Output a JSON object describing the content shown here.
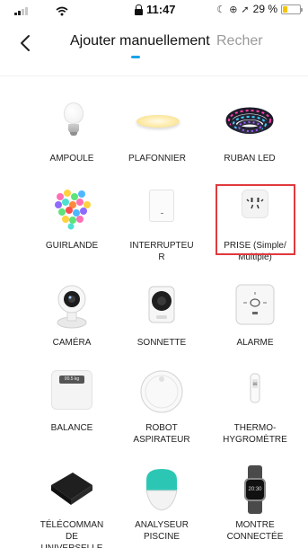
{
  "status_bar": {
    "time": "11:47",
    "battery_text": "29 %",
    "battery_level": 0.29,
    "icons": [
      "signal-icon",
      "wifi-icon",
      "lock-icon",
      "moon-icon",
      "location-icon",
      "battery-icon"
    ]
  },
  "header": {
    "back_icon": "chevron-left-icon",
    "tabs": [
      {
        "label": "Ajouter manuellement",
        "active": true
      },
      {
        "label": "Recher",
        "active": false
      }
    ],
    "accent_color": "#1aa3e8"
  },
  "selection_color": "#e0393e",
  "devices": [
    {
      "label": "AMPOULE",
      "icon": "bulb-icon"
    },
    {
      "label": "PLAFONNIER",
      "icon": "ceiling-light-icon"
    },
    {
      "label": "RUBAN LED",
      "icon": "led-strip-icon"
    },
    {
      "label": "GUIRLANDE",
      "icon": "string-lights-icon"
    },
    {
      "label": "INTERRUPTEU\nR",
      "icon": "switch-icon"
    },
    {
      "label": "PRISE (Simple/\nMultiple)",
      "icon": "socket-icon",
      "selected": true
    },
    {
      "label": "CAMÉRA",
      "icon": "camera-icon"
    },
    {
      "label": "SONNETTE",
      "icon": "doorbell-icon"
    },
    {
      "label": "ALARME",
      "icon": "alarm-icon"
    },
    {
      "label": "BALANCE",
      "icon": "scale-icon",
      "display_text": "00.5 kg"
    },
    {
      "label": "ROBOT\nASPIRATEUR",
      "icon": "robot-vacuum-icon"
    },
    {
      "label": "THERMO-\nHYGROMÈTRE",
      "icon": "thermo-hygrometer-icon"
    },
    {
      "label": "TÉLÉCOMMAN\nDE\nUNIVERSELLE",
      "icon": "remote-hub-icon"
    },
    {
      "label": "ANALYSEUR\nPISCINE",
      "icon": "pool-analyzer-icon"
    },
    {
      "label": "MONTRE\nCONNECTÉE",
      "icon": "smartwatch-icon",
      "display_text": "20:30"
    }
  ]
}
